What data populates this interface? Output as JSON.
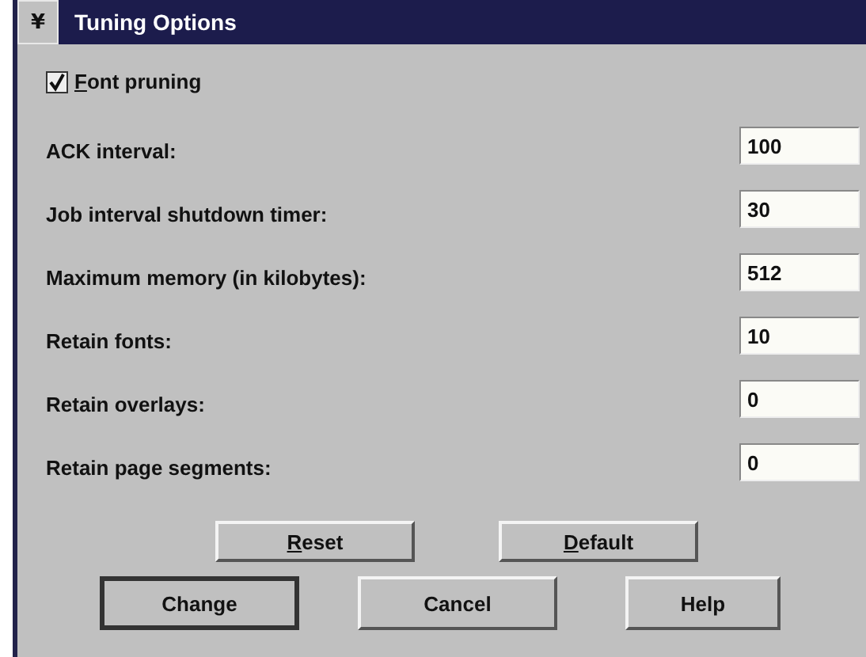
{
  "window": {
    "title": "Tuning Options",
    "menu_glyph": "¥"
  },
  "font_pruning": {
    "label": "Font pruning",
    "checked": true,
    "mnemonic": true
  },
  "fields": [
    {
      "label": "ACK interval:",
      "value": "100"
    },
    {
      "label": "Job interval shutdown timer:",
      "value": "30"
    },
    {
      "label": "Maximum memory (in kilobytes):",
      "value": "512"
    },
    {
      "label": "Retain fonts:",
      "value": "10"
    },
    {
      "label": "Retain overlays:",
      "value": "0"
    },
    {
      "label": "Retain page segments:",
      "value": "0"
    }
  ],
  "buttons_top": [
    {
      "label": "Reset",
      "mnemonic": true,
      "default": false
    },
    {
      "label": "Default",
      "mnemonic": true,
      "default": false
    }
  ],
  "buttons_bottom": [
    {
      "label": "Change",
      "mnemonic": false,
      "default": true
    },
    {
      "label": "Cancel",
      "mnemonic": false,
      "default": false
    },
    {
      "label": "Help",
      "mnemonic": false,
      "default": false
    }
  ]
}
